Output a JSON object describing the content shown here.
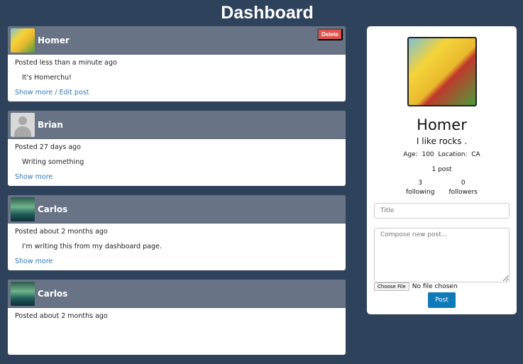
{
  "title": "Dashboard",
  "posts": [
    {
      "user": "Homer",
      "avatar": "homer",
      "time": "Posted less than a minute ago",
      "text": "It's Homerchu!",
      "link": "Show more / Edit post",
      "delete": "Delete"
    },
    {
      "user": "Brian",
      "avatar": "brian",
      "time": "Posted 27 days ago",
      "text": "Writing something",
      "link": "Show more"
    },
    {
      "user": "Carlos",
      "avatar": "carlos",
      "time": "Posted about 2 months ago",
      "text": "I'm writing this from my dashboard page.",
      "link": "Show more"
    },
    {
      "user": "Carlos",
      "avatar": "carlos",
      "time": "Posted about 2 months ago",
      "text": "",
      "link": ""
    }
  ],
  "profile": {
    "name": "Homer",
    "bio": "I like rocks .",
    "age_label": "Age:",
    "age": "100",
    "location_label": "Location:",
    "location": "CA",
    "posts": "1 post",
    "following_count": "3",
    "following_label": "following",
    "followers_count": "0",
    "followers_label": "followers",
    "title_placeholder": "Title",
    "compose_placeholder": "Compose new post...",
    "choose_file": "Choose File",
    "no_file": "No file chosen",
    "post_button": "Post"
  },
  "colors": {
    "background": "#2f425c",
    "card_header": "#687486",
    "delete": "#e4504a",
    "link": "#337ab7",
    "post_button": "#0e7ab8"
  }
}
